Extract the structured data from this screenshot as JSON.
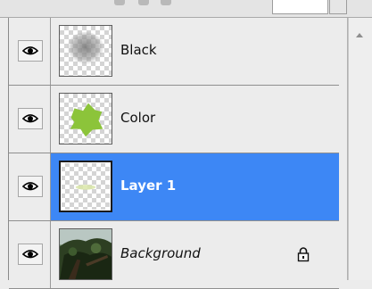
{
  "layers_panel": {
    "layers": [
      {
        "name": "Black",
        "visible": true,
        "selected": false,
        "locked": false,
        "italic": false,
        "thumbnail": "gray-blur-on-transparent",
        "visibility_icon": "eye-icon"
      },
      {
        "name": "Color",
        "visible": true,
        "selected": false,
        "locked": false,
        "italic": false,
        "thumbnail": "green-blob-on-transparent",
        "visibility_icon": "eye-icon"
      },
      {
        "name": "Layer 1",
        "visible": true,
        "selected": true,
        "locked": false,
        "italic": false,
        "thumbnail": "faint-mark-on-transparent",
        "visibility_icon": "eye-icon"
      },
      {
        "name": "Background",
        "visible": true,
        "selected": false,
        "locked": true,
        "italic": true,
        "thumbnail": "tree-photo",
        "visibility_icon": "eye-icon",
        "lock_icon": "lock-icon"
      }
    ]
  },
  "colors": {
    "selection": "#3d87f5",
    "panel_bg": "#ececec",
    "green_blob": "#8cc43a"
  }
}
